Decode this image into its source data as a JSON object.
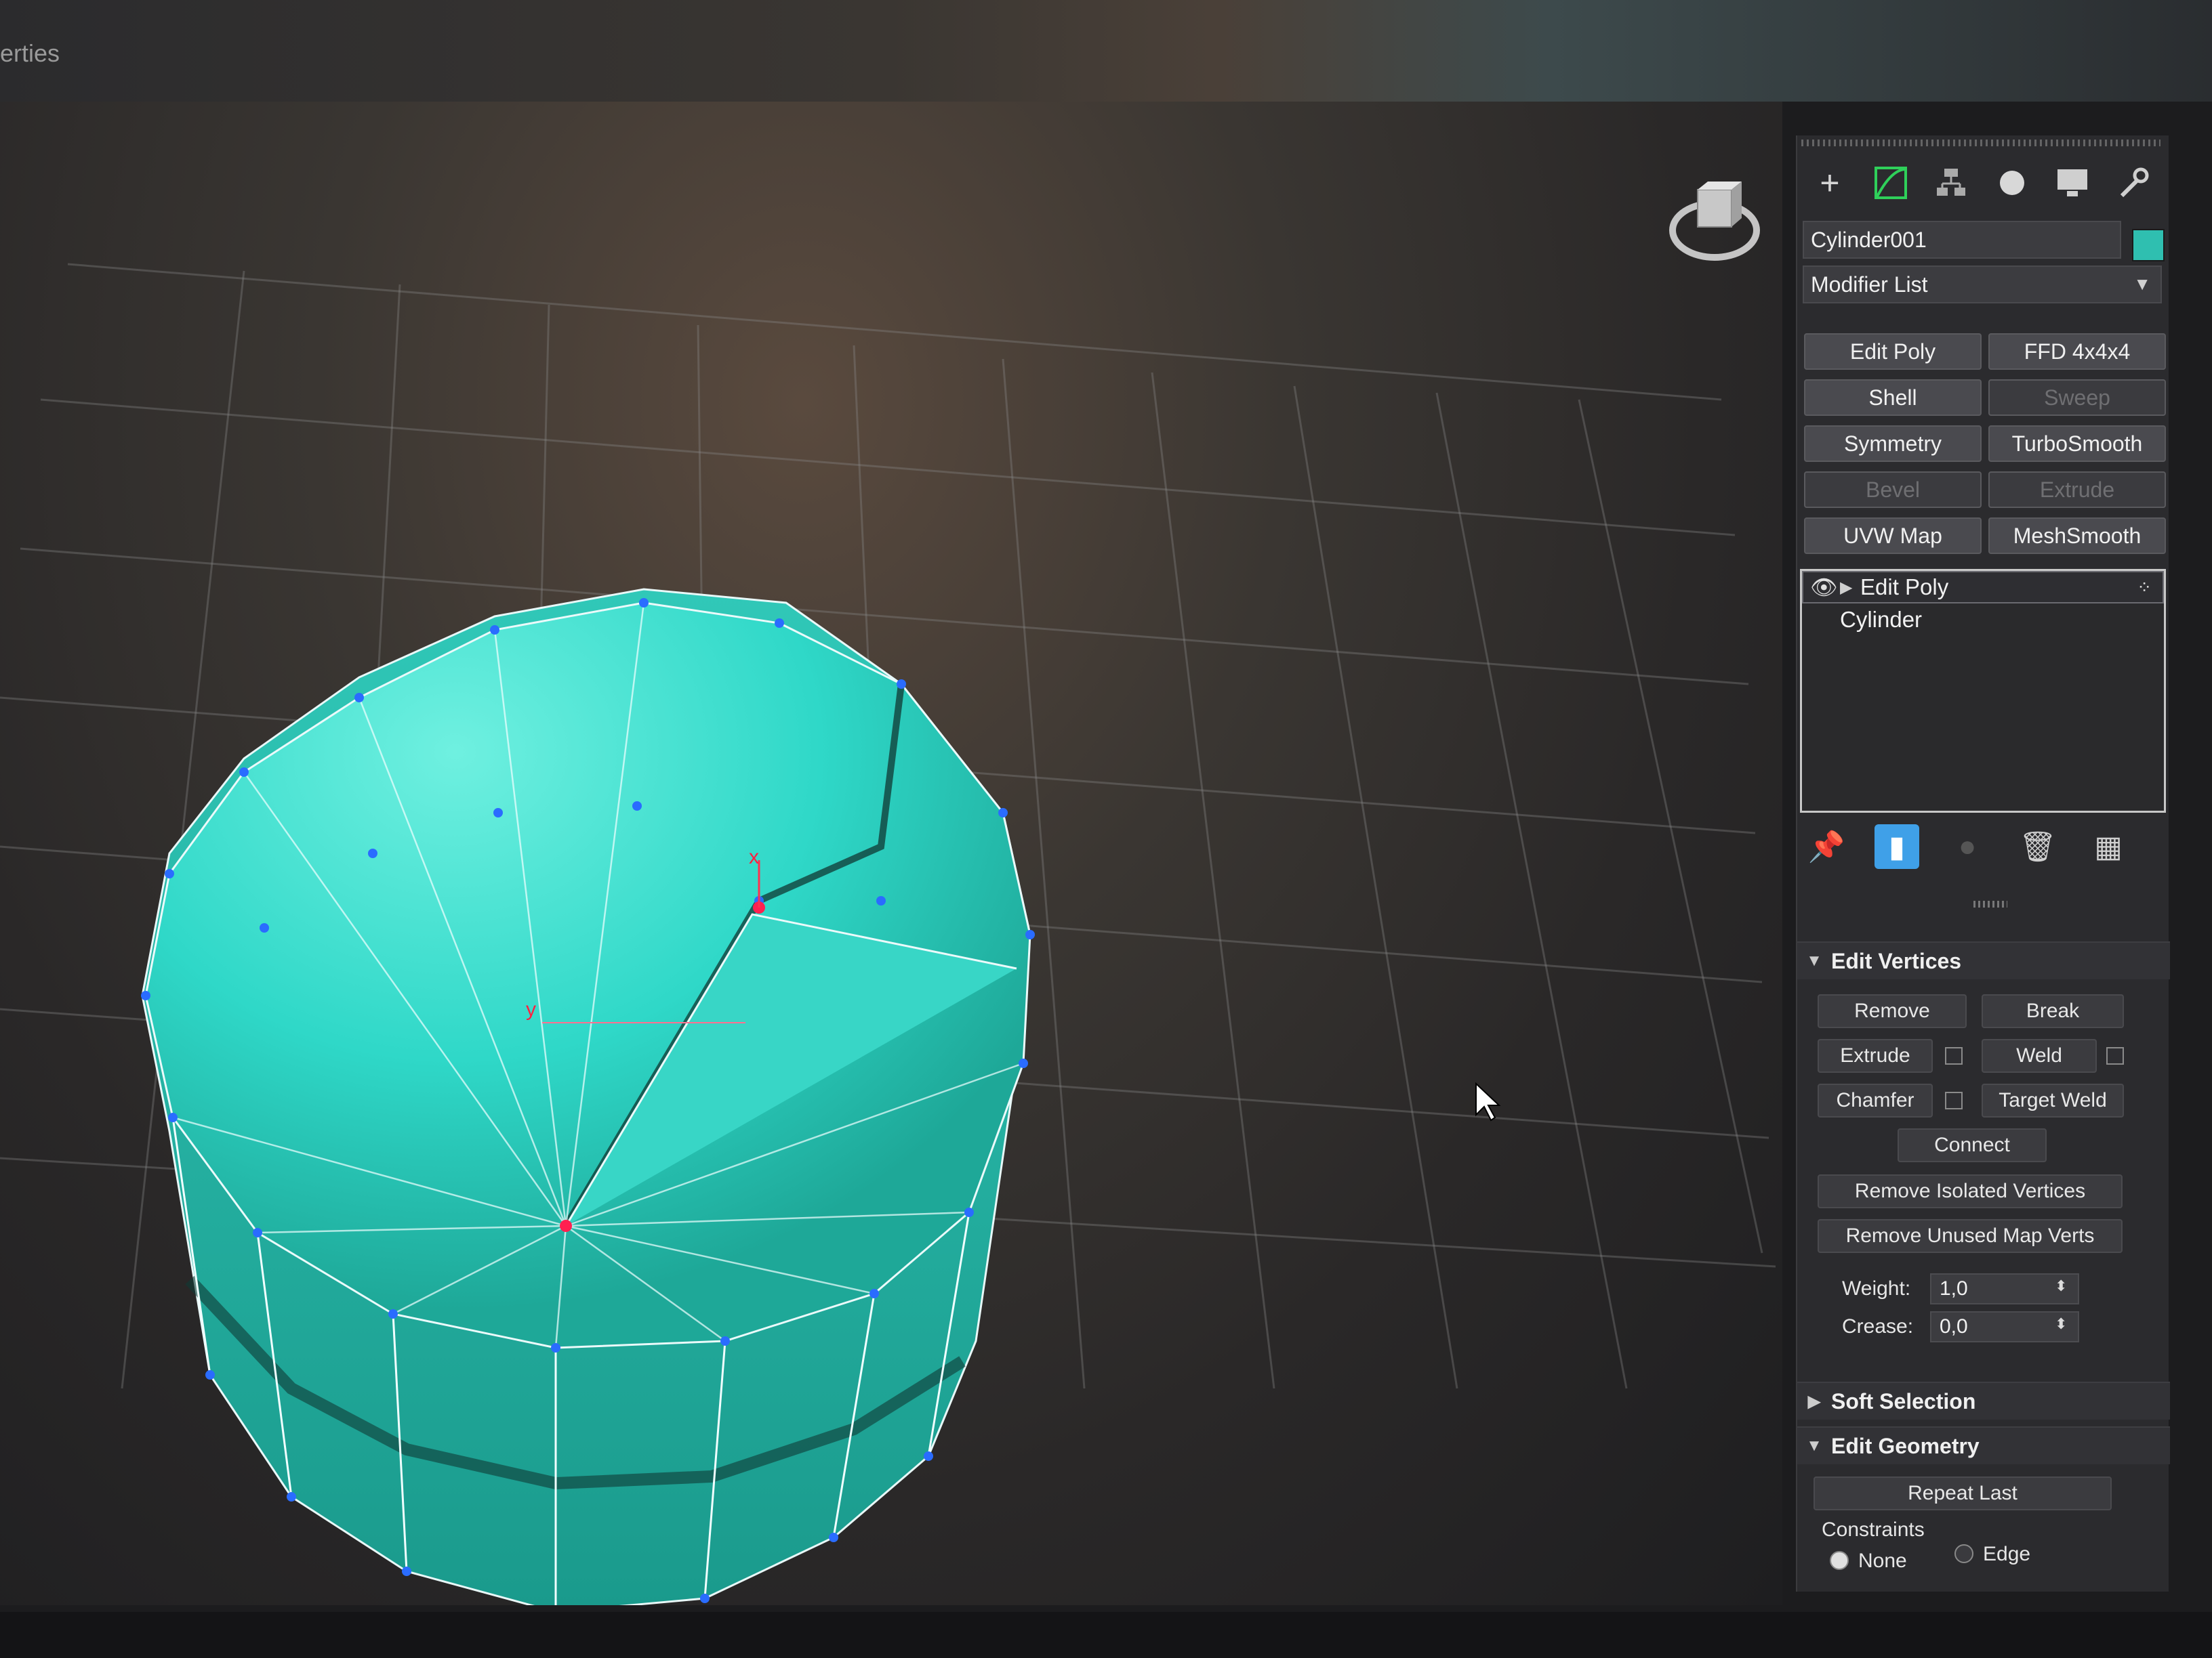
{
  "top": {
    "tab_label": "erties"
  },
  "command_panel": {
    "tabs": [
      "create-icon",
      "modify-icon",
      "hierarchy-icon",
      "motion-icon",
      "display-icon",
      "utilities-icon"
    ],
    "object_name": "Cylinder001",
    "object_color": "#2fbfb0",
    "modifier_list_label": "Modifier List",
    "modifier_buttons": [
      {
        "label": "Edit Poly",
        "enabled": true
      },
      {
        "label": "FFD 4x4x4",
        "enabled": true
      },
      {
        "label": "Shell",
        "enabled": true
      },
      {
        "label": "Sweep",
        "enabled": false
      },
      {
        "label": "Symmetry",
        "enabled": true
      },
      {
        "label": "TurboSmooth",
        "enabled": true
      },
      {
        "label": "Bevel",
        "enabled": false
      },
      {
        "label": "Extrude",
        "enabled": false
      },
      {
        "label": "UVW Map",
        "enabled": true
      },
      {
        "label": "MeshSmooth",
        "enabled": true
      }
    ],
    "stack": {
      "top": "Edit Poly",
      "base": "Cylinder"
    },
    "stack_tools": [
      "pin-icon",
      "show-end-result-icon",
      "make-unique-icon",
      "trash-icon",
      "configure-icon"
    ]
  },
  "edit_vertices": {
    "title": "Edit Vertices",
    "remove": "Remove",
    "break": "Break",
    "extrude": "Extrude",
    "weld": "Weld",
    "chamfer": "Chamfer",
    "target_weld": "Target Weld",
    "connect": "Connect",
    "remove_isolated": "Remove Isolated Vertices",
    "remove_unused": "Remove Unused Map Verts",
    "weight_label": "Weight:",
    "weight_value": "1,0",
    "crease_label": "Crease:",
    "crease_value": "0,0"
  },
  "soft_selection": {
    "title": "Soft Selection"
  },
  "edit_geometry": {
    "title": "Edit Geometry",
    "repeat_last": "Repeat Last",
    "constraints_label": "Constraints",
    "none": "None",
    "edge": "Edge"
  },
  "viewport": {
    "gizmo_x": "x",
    "gizmo_y": "y",
    "mesh_color": "#2fd8c8"
  }
}
